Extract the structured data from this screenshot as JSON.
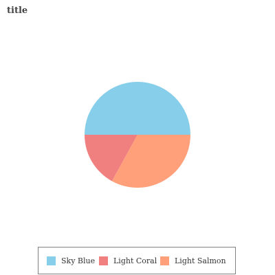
{
  "chart_data": {
    "type": "pie",
    "title": "title",
    "categories": [
      "Sky Blue",
      "Light Coral",
      "Light Salmon"
    ],
    "values": [
      50,
      17,
      33
    ],
    "colors": [
      "#87ceeb",
      "#f08080",
      "#ffa07a"
    ],
    "legend_position": "bottom"
  }
}
